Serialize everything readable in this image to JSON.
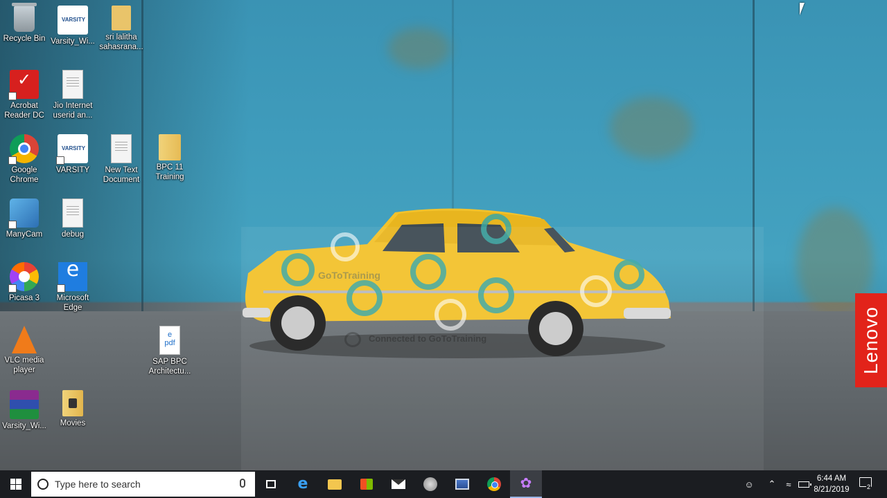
{
  "desktop": {
    "icons": [
      {
        "label": "Recycle Bin",
        "icon": "recycle-bin-icon"
      },
      {
        "label": "Varsity_Wi...",
        "icon": "varsity-icon"
      },
      {
        "label": "sri lalitha sahasrana...",
        "icon": "folder-icon"
      },
      {
        "label": "Acrobat Reader DC",
        "icon": "acrobat-icon"
      },
      {
        "label": "Jio Internet userid an...",
        "icon": "text-document-icon"
      },
      {
        "label": "Google Chrome",
        "icon": "chrome-icon"
      },
      {
        "label": "VARSITY",
        "icon": "varsity-icon"
      },
      {
        "label": "New Text Document",
        "icon": "text-document-icon"
      },
      {
        "label": "BPC 11 Training",
        "icon": "folder-icon"
      },
      {
        "label": "ManyCam",
        "icon": "manycam-icon"
      },
      {
        "label": "debug",
        "icon": "text-document-icon"
      },
      {
        "label": "Picasa 3",
        "icon": "picasa-icon"
      },
      {
        "label": "Microsoft Edge",
        "icon": "edge-icon"
      },
      {
        "label": "VLC media player",
        "icon": "vlc-icon"
      },
      {
        "label": "SAP BPC Architectu...",
        "icon": "pdf-document-icon"
      },
      {
        "label": "Varsity_Wi...",
        "icon": "winrar-icon"
      },
      {
        "label": "Movies",
        "icon": "folder-icon"
      }
    ],
    "varsity_logo_text": "VARSITY",
    "watermark": "Connected to GoToTraining",
    "watermark_small": "GoToTraining",
    "brand_tab": "Lenovo"
  },
  "taskbar": {
    "search_placeholder": "Type here to search",
    "pinned": [
      {
        "name": "task-view",
        "icon": "task-view-icon"
      },
      {
        "name": "edge",
        "icon": "edge-icon"
      },
      {
        "name": "file-explorer",
        "icon": "folder-icon"
      },
      {
        "name": "store",
        "icon": "store-icon"
      },
      {
        "name": "mail",
        "icon": "mail-icon"
      },
      {
        "name": "app-circle",
        "icon": "app-circle-icon"
      },
      {
        "name": "remote-desktop",
        "icon": "computer-icon"
      },
      {
        "name": "chrome",
        "icon": "chrome-icon"
      },
      {
        "name": "gototraining",
        "icon": "gototraining-icon"
      }
    ],
    "time": "6:44 AM",
    "date": "8/21/2019",
    "notification_count": "2"
  },
  "colors": {
    "taskbar_bg": "#1b1d21",
    "lenovo_red": "#e2231a",
    "car_yellow": "#f3c22b",
    "wall_blue": "#3f9cbc"
  }
}
